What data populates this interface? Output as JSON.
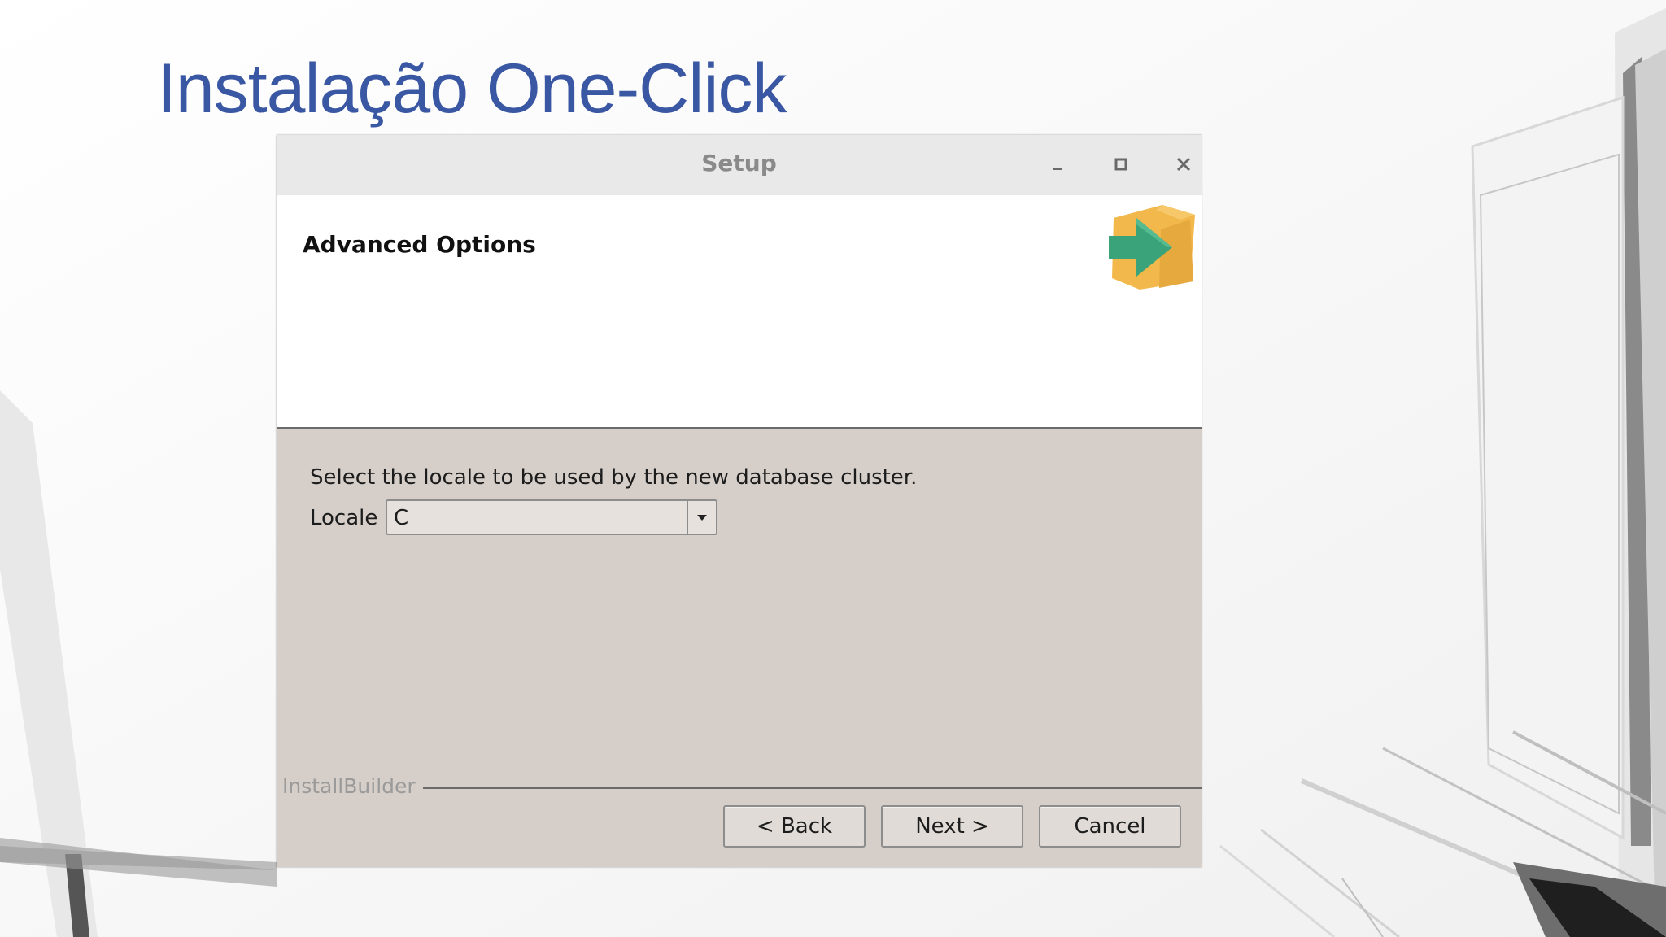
{
  "slide": {
    "title": "Instalação One-Click"
  },
  "window": {
    "title": "Setup",
    "controls": {
      "minimize": "minimize-icon",
      "maximize": "maximize-icon",
      "close": "close-icon"
    }
  },
  "header": {
    "title": "Advanced Options",
    "icon": "installer-box-arrow-icon"
  },
  "content": {
    "instruction": "Select the locale to be used by the new database cluster.",
    "locale_label": "Locale",
    "locale_value": "C"
  },
  "footer": {
    "brand": "InstallBuilder",
    "back_label": "< Back",
    "next_label": "Next >",
    "cancel_label": "Cancel"
  },
  "colors": {
    "title_blue": "#3a57a3",
    "dialog_bg": "#d6cfc9",
    "arrow_green": "#3aa37a",
    "box_orange": "#f2b84b"
  }
}
